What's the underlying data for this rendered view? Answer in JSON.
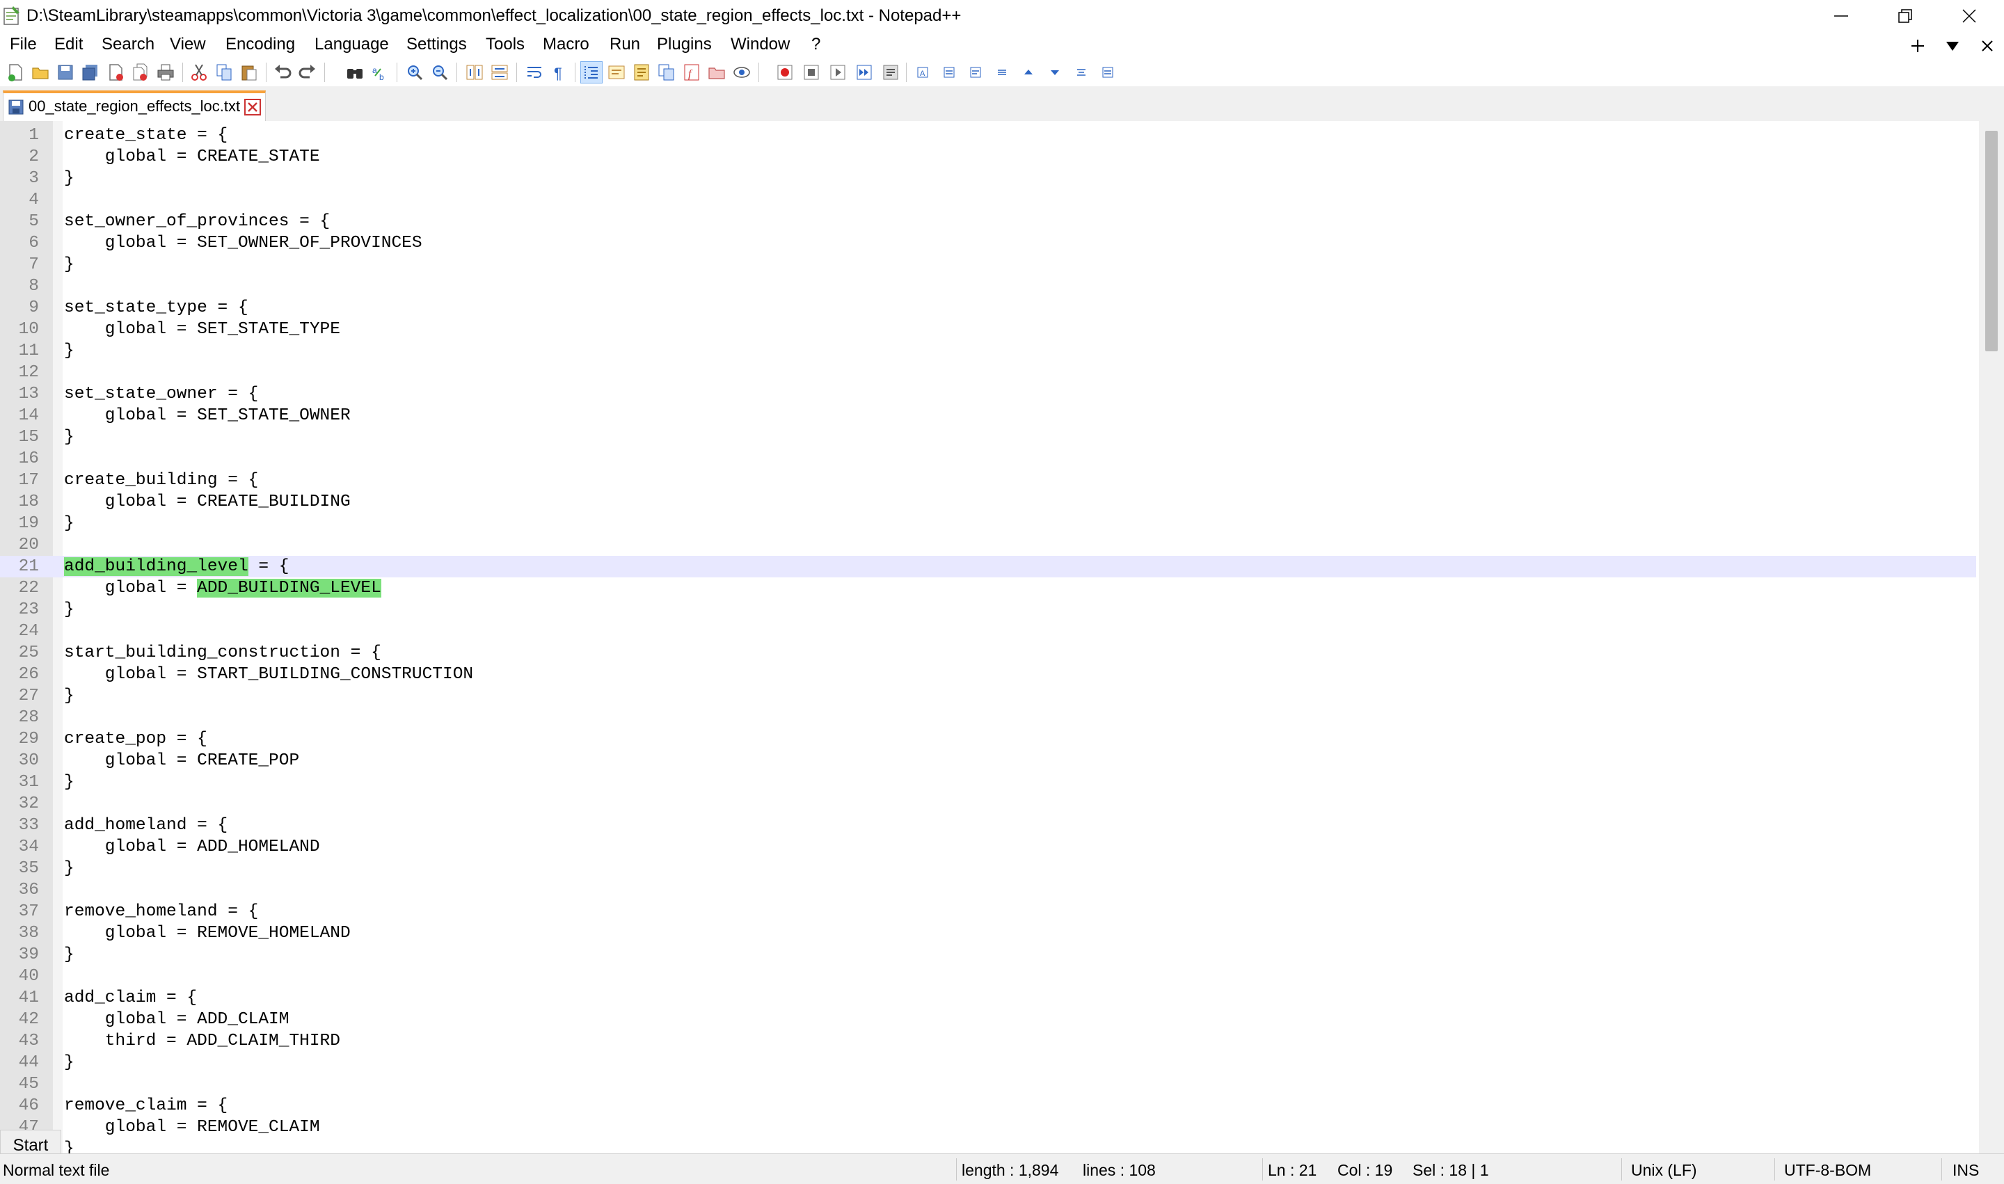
{
  "window": {
    "title": "D:\\SteamLibrary\\steamapps\\common\\Victoria 3\\game\\common\\effect_localization\\00_state_region_effects_loc.txt - Notepad++"
  },
  "menu": [
    "File",
    "Edit",
    "Search",
    "View",
    "Encoding",
    "Language",
    "Settings",
    "Tools",
    "Macro",
    "Run",
    "Plugins",
    "Window",
    "?"
  ],
  "tab": {
    "label": "00_state_region_effects_loc.txt"
  },
  "editor": {
    "current_line": 21,
    "lines": [
      "create_state = {",
      "    global = CREATE_STATE",
      "}",
      "",
      "set_owner_of_provinces = {",
      "    global = SET_OWNER_OF_PROVINCES",
      "}",
      "",
      "set_state_type = {",
      "    global = SET_STATE_TYPE",
      "}",
      "",
      "set_state_owner = {",
      "    global = SET_STATE_OWNER",
      "}",
      "",
      "create_building = {",
      "    global = CREATE_BUILDING",
      "}",
      "",
      "add_building_level = {",
      "    global = ADD_BUILDING_LEVEL",
      "}",
      "",
      "start_building_construction = {",
      "    global = START_BUILDING_CONSTRUCTION",
      "}",
      "",
      "create_pop = {",
      "    global = CREATE_POP",
      "}",
      "",
      "add_homeland = {",
      "    global = ADD_HOMELAND",
      "}",
      "",
      "remove_homeland = {",
      "    global = REMOVE_HOMELAND",
      "}",
      "",
      "add_claim = {",
      "    global = ADD_CLAIM",
      "    third = ADD_CLAIM_THIRD",
      "}",
      "",
      "remove_claim = {",
      "    global = REMOVE_CLAIM",
      "}"
    ],
    "highlights": [
      {
        "line": 21,
        "text": "add_building_level"
      },
      {
        "line": 22,
        "text": "ADD_BUILDING_LEVEL"
      }
    ],
    "scroll_fraction_visible": 0.435
  },
  "start_button": "Start",
  "status": {
    "file_type": "Normal text file",
    "length": "length : 1,894",
    "lines": "lines : 108",
    "ln": "Ln : 21",
    "col": "Col : 19",
    "sel": "Sel : 18 | 1",
    "eol": "Unix (LF)",
    "encoding": "UTF-8-BOM",
    "mode": "INS"
  },
  "colors": {
    "tab_accent": "#f7a13a",
    "highlight": "#7be07b",
    "current_line": "#e8e8ff",
    "gutter": "#e4e4e4"
  },
  "icons": [
    "notepad-plus-plus-icon",
    "minimize-icon",
    "restore-icon",
    "close-icon",
    "new-tab-icon",
    "tab-list-icon",
    "close-doc-icon",
    "save-icon",
    "tab-close-icon"
  ]
}
